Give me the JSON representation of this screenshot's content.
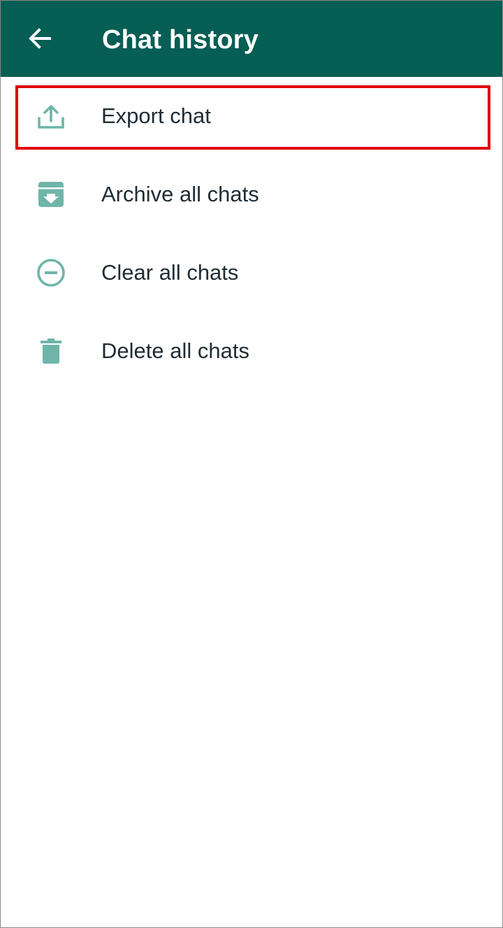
{
  "colors": {
    "appbar": "#075e54",
    "icon": "#6fb5a9",
    "text": "#1f2c34",
    "highlight": "#e00000"
  },
  "header": {
    "title": "Chat history",
    "back_icon": "arrow-left-icon"
  },
  "menu": {
    "items": [
      {
        "label": "Export chat",
        "icon": "export-upload-icon",
        "highlighted": true
      },
      {
        "label": "Archive all chats",
        "icon": "archive-box-icon",
        "highlighted": false
      },
      {
        "label": "Clear all chats",
        "icon": "minus-circle-icon",
        "highlighted": false
      },
      {
        "label": "Delete all chats",
        "icon": "trash-can-icon",
        "highlighted": false
      }
    ]
  }
}
